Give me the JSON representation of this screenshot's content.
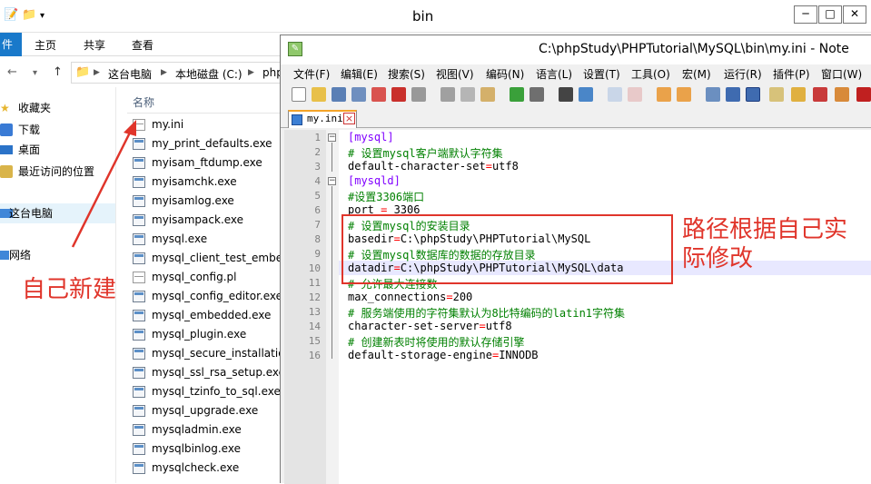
{
  "explorer": {
    "title": "bin",
    "ribbon_tabs": [
      "件",
      "主页",
      "共享",
      "查看"
    ],
    "window_buttons": [
      "─",
      "□",
      "✕"
    ],
    "breadcrumb": [
      "这台电脑",
      "本地磁盘 (C:)",
      "php"
    ],
    "nav_items": [
      {
        "label": "收藏夹",
        "icon": "star-icon"
      },
      {
        "label": "下载",
        "icon": "download-folder-icon"
      },
      {
        "label": "桌面",
        "icon": "desktop-icon"
      },
      {
        "label": "最近访问的位置",
        "icon": "recent-places-icon"
      },
      {
        "label": "这台电脑",
        "icon": "computer-icon"
      },
      {
        "label": "网络",
        "icon": "network-icon"
      }
    ],
    "column_header": "名称",
    "files": [
      "my.ini",
      "my_print_defaults.exe",
      "myisam_ftdump.exe",
      "myisamchk.exe",
      "myisamlog.exe",
      "myisampack.exe",
      "mysql.exe",
      "mysql_client_test_embed",
      "mysql_config.pl",
      "mysql_config_editor.exe",
      "mysql_embedded.exe",
      "mysql_plugin.exe",
      "mysql_secure_installation",
      "mysql_ssl_rsa_setup.exe",
      "mysql_tzinfo_to_sql.exe",
      "mysql_upgrade.exe",
      "mysqladmin.exe",
      "mysqlbinlog.exe",
      "mysqlcheck.exe"
    ]
  },
  "annotations": {
    "left": "自己新建",
    "right": "路径根据自己实际修改",
    "color": "#e0352b"
  },
  "notepad": {
    "title": "C:\\phpStudy\\PHPTutorial\\MySQL\\bin\\my.ini - Note",
    "menu": [
      "文件(F)",
      "编辑(E)",
      "搜索(S)",
      "视图(V)",
      "编码(N)",
      "语言(L)",
      "设置(T)",
      "工具(O)",
      "宏(M)",
      "运行(R)",
      "插件(P)",
      "窗口(W)"
    ],
    "tab_name": "my.ini",
    "line_numbers": [
      "1",
      "2",
      "3",
      "4",
      "5",
      "6",
      "7",
      "8",
      "9",
      "10",
      "11",
      "12",
      "13",
      "14",
      "15",
      "16"
    ],
    "lines": [
      {
        "type": "sec",
        "text": "[mysql]"
      },
      {
        "type": "cm",
        "text": "# 设置mysql客户端默认字符集"
      },
      {
        "type": "kv",
        "key": "default-character-set",
        "eq": "=",
        "val": "utf8"
      },
      {
        "type": "sec",
        "text": "[mysqld]"
      },
      {
        "type": "cm",
        "text": "#设置3306端口"
      },
      {
        "type": "kv",
        "key": "port ",
        "eq": "=",
        "val": " 3306"
      },
      {
        "type": "cm",
        "text": "# 设置mysql的安装目录"
      },
      {
        "type": "kv",
        "key": "basedir",
        "eq": "=",
        "val": "C:\\phpStudy\\PHPTutorial\\MySQL"
      },
      {
        "type": "cm",
        "text": "# 设置mysql数据库的数据的存放目录"
      },
      {
        "type": "kv",
        "key": "datadir",
        "eq": "=",
        "val": "C:\\phpStudy\\PHPTutorial\\MySQL\\data"
      },
      {
        "type": "cm",
        "text": "# 允许最大连接数"
      },
      {
        "type": "kv",
        "key": "max_connections",
        "eq": "=",
        "val": "200"
      },
      {
        "type": "cm",
        "text": "# 服务端使用的字符集默认为8比特编码的latin1字符集"
      },
      {
        "type": "kv",
        "key": "character-set-server",
        "eq": "=",
        "val": "utf8"
      },
      {
        "type": "cm",
        "text": "# 创建新表时将使用的默认存储引擎"
      },
      {
        "type": "kv",
        "key": "default-storage-engine",
        "eq": "=",
        "val": "INNODB"
      }
    ]
  }
}
